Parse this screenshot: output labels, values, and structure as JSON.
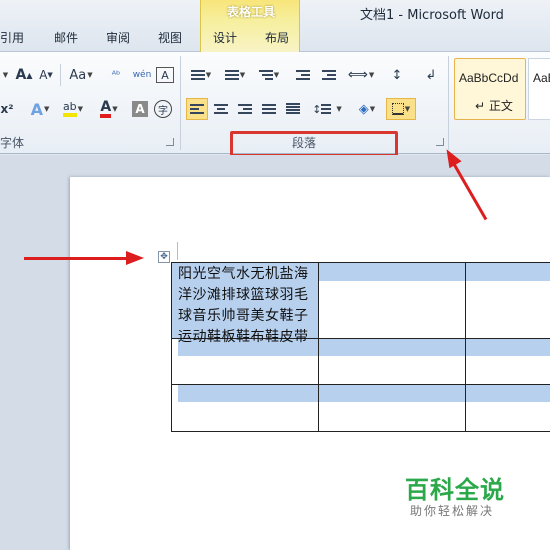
{
  "window": {
    "title": "文档1  -  Microsoft Word"
  },
  "tabs": [
    "引用",
    "邮件",
    "审阅",
    "视图",
    "设计",
    "布局"
  ],
  "context_group": {
    "title": "表格工具"
  },
  "ribbon": {
    "font_group": {
      "label": "字体",
      "grow_font": "A",
      "shrink_font": "A",
      "change_case": "Aa",
      "clear_format": "A",
      "font_color": "A",
      "char_shading": "A",
      "enclose_char": "字"
    },
    "paragraph_group": {
      "label": "段落"
    },
    "styles_group": {
      "style_preview": "AaBbCcDd",
      "style_name": "↵ 正文",
      "style_preview_2": "AaB"
    }
  },
  "table": {
    "cell_text": "阳光空气水无机盐海洋沙滩排球篮球羽毛球音乐帅哥美女鞋子运动鞋板鞋布鞋皮带"
  },
  "watermark": {
    "title": "百科全说",
    "subtitle": "助你轻松解决"
  },
  "colors": {
    "annotation_red": "#dd1e1e",
    "selection_blue": "#b7d0ee",
    "context_yellow": "#f8e57a"
  }
}
